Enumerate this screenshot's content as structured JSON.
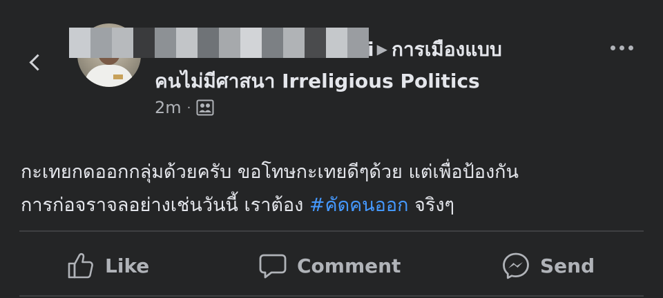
{
  "post": {
    "author_suffix": "i",
    "group_line1": "การเมืองแบบ",
    "group_line2": "คนไม่มีศาสนา Irreligious Politics",
    "timestamp": "2m",
    "separator": "·",
    "privacy_icon": "group-members-icon",
    "body_line1": "กะเทยกดออกกลุ่มด้วยครับ ขอโทษกะเทยดีๆด้วย แต่เพื่อป้องกัน",
    "body_line2_prefix": "การก่อจราจลอย่างเช่นวันนี้ เราต้อง",
    "hashtag": "#คัดคนออก",
    "body_line2_suffix": "จริงๆ"
  },
  "actions": {
    "like_label": "Like",
    "comment_label": "Comment",
    "send_label": "Send"
  },
  "icons": {
    "back": "chevron-left-icon",
    "more": "more-horizontal-icon",
    "like": "thumbs-up-icon",
    "comment": "speech-bubble-icon",
    "send": "messenger-icon"
  },
  "colors": {
    "background": "#242526",
    "primary_text": "#e4e6eb",
    "secondary_text": "#b0b3b8",
    "hashtag": "#4599ff",
    "divider": "#3e4042"
  }
}
